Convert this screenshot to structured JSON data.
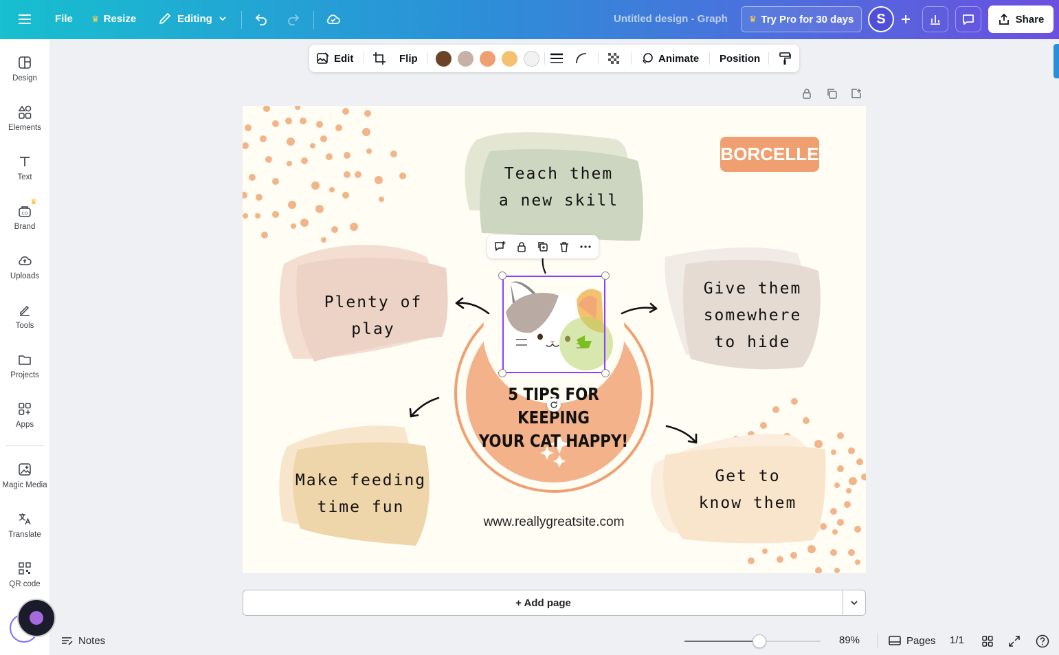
{
  "topbar": {
    "file_label": "File",
    "resize_label": "Resize",
    "editing_label": "Editing",
    "design_title": "Untitled design - Graph",
    "pro_label": "Try Pro for 30 days",
    "avatar_initial": "S",
    "share_label": "Share"
  },
  "sidebar": {
    "items": [
      {
        "label": "Design",
        "icon": "design-icon"
      },
      {
        "label": "Elements",
        "icon": "elements-icon"
      },
      {
        "label": "Text",
        "icon": "text-icon"
      },
      {
        "label": "Brand",
        "icon": "brand-icon"
      },
      {
        "label": "Uploads",
        "icon": "uploads-icon"
      },
      {
        "label": "Tools",
        "icon": "tools-icon"
      },
      {
        "label": "Projects",
        "icon": "projects-icon"
      },
      {
        "label": "Apps",
        "icon": "apps-icon"
      },
      {
        "label": "Magic Media",
        "icon": "magic-media-icon"
      },
      {
        "label": "Translate",
        "icon": "translate-icon"
      },
      {
        "label": "QR code",
        "icon": "qr-code-icon"
      }
    ]
  },
  "toolbar": {
    "edit_label": "Edit",
    "flip_label": "Flip",
    "animate_label": "Animate",
    "position_label": "Position",
    "swatches": [
      "#6b4428",
      "#c7b0a6",
      "#f0a070",
      "#f4c26e",
      "#f2f2f2"
    ]
  },
  "canvas": {
    "brand": "BORCELLE",
    "tip_teach": [
      "Teach them",
      "a new skill"
    ],
    "tip_play": "Plenty of play",
    "tip_hide": [
      "Give them",
      "somewhere",
      "to hide"
    ],
    "tip_feeding": [
      "Make feeding",
      "time fun"
    ],
    "tip_know": [
      "Get to",
      "know them"
    ],
    "headline": [
      "5 TIPS FOR KEEPING",
      "YOUR CAT HAPPY!"
    ],
    "website": "www.reallygreatsite.com"
  },
  "bottom": {
    "add_page_label": "+ Add page",
    "notes_label": "Notes",
    "zoom_value": "89%",
    "zoom_level": 0.55,
    "pages_label": "Pages",
    "page_count": "1/1"
  }
}
